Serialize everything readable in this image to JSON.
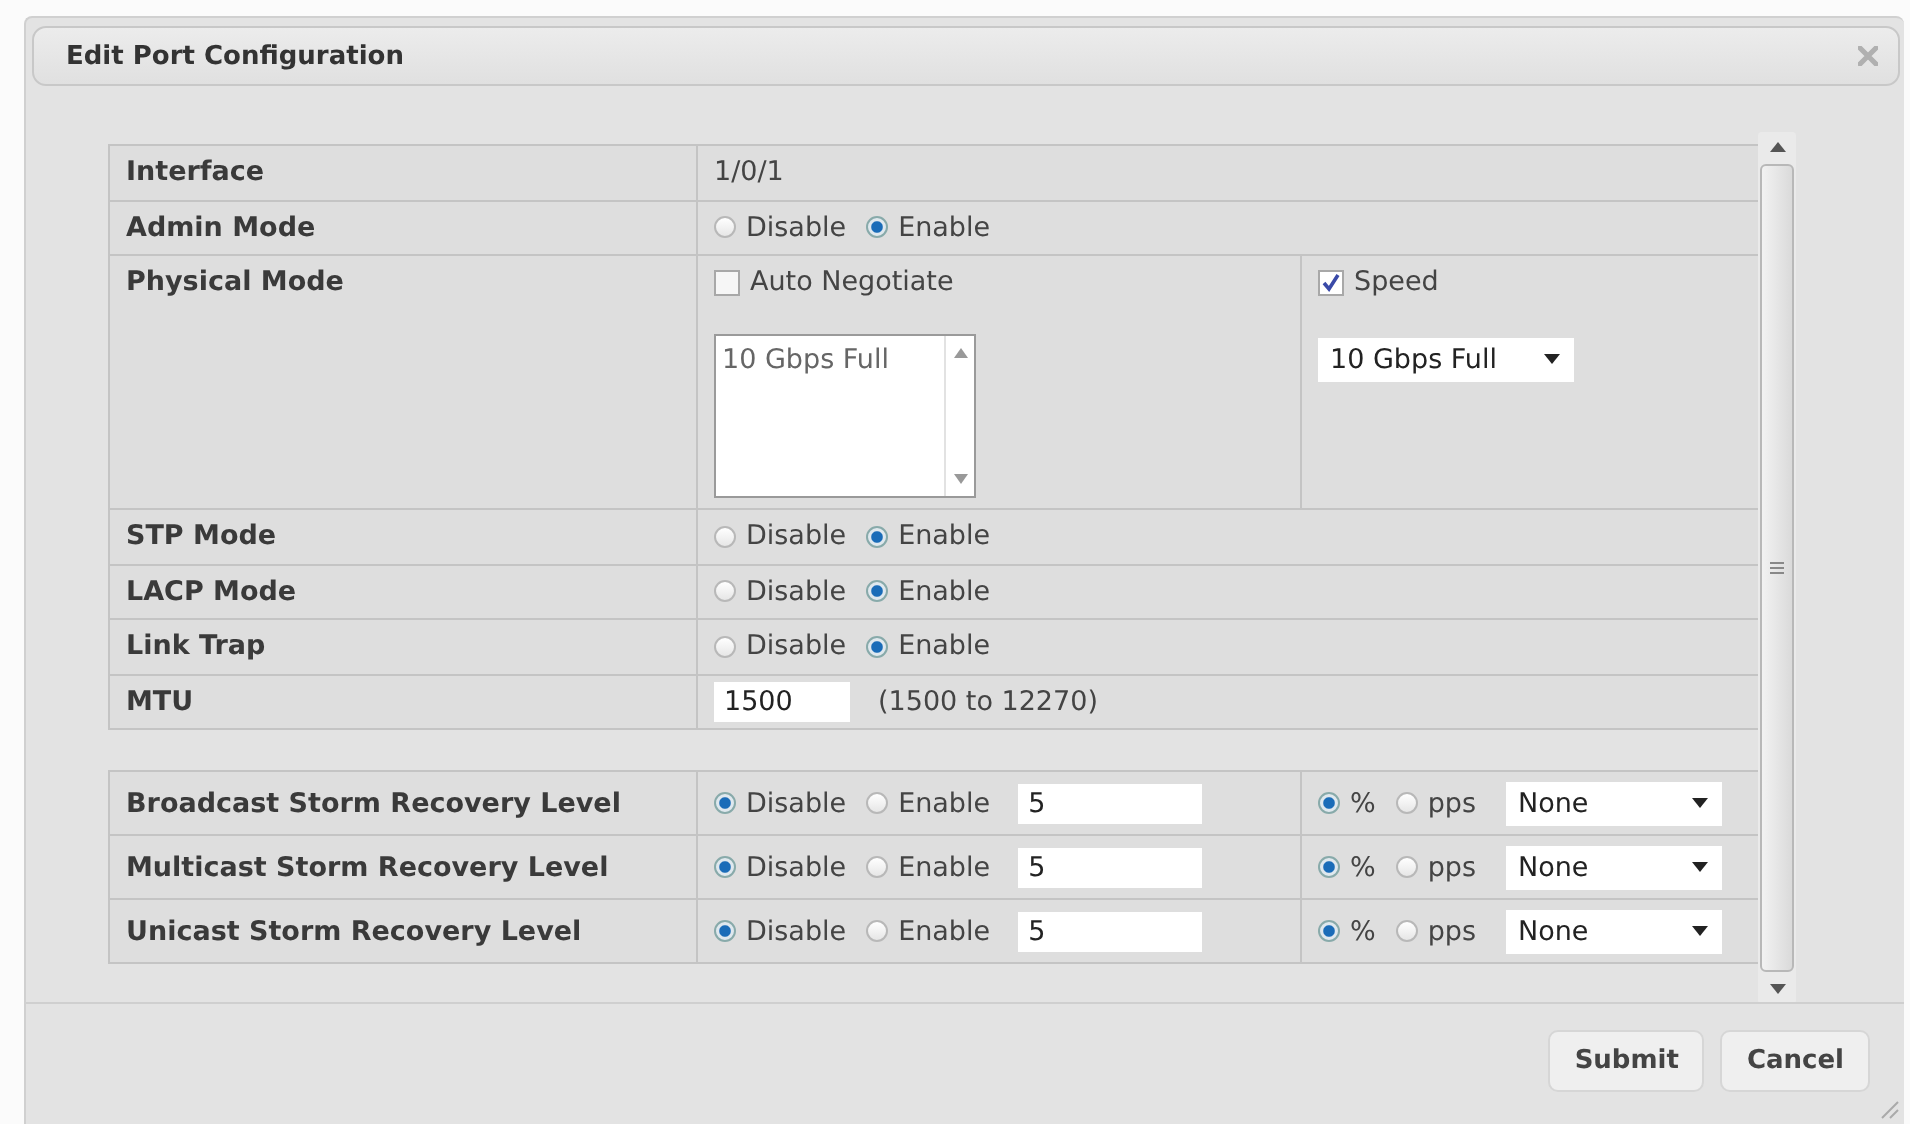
{
  "dialog": {
    "title": "Edit Port Configuration"
  },
  "rows": [
    {
      "kind": "text",
      "label": "Interface",
      "value": "1/0/1"
    },
    {
      "kind": "radio",
      "label": "Admin Mode",
      "options": [
        {
          "label": "Disable",
          "selected": false
        },
        {
          "label": "Enable",
          "selected": true
        }
      ]
    },
    {
      "kind": "physical",
      "label": "Physical Mode",
      "auto_negotiate": {
        "label": "Auto Negotiate",
        "checked": false
      },
      "list_items": [
        "10 Gbps Full"
      ],
      "speed": {
        "label": "Speed",
        "checked": true
      },
      "speed_select": "10 Gbps Full"
    },
    {
      "kind": "radio",
      "label": "STP Mode",
      "options": [
        {
          "label": "Disable",
          "selected": false
        },
        {
          "label": "Enable",
          "selected": true
        }
      ]
    },
    {
      "kind": "radio",
      "label": "LACP Mode",
      "options": [
        {
          "label": "Disable",
          "selected": false
        },
        {
          "label": "Enable",
          "selected": true
        }
      ]
    },
    {
      "kind": "radio",
      "label": "Link Trap",
      "options": [
        {
          "label": "Disable",
          "selected": false
        },
        {
          "label": "Enable",
          "selected": true
        }
      ]
    },
    {
      "kind": "number",
      "label": "MTU",
      "value": "1500",
      "hint": "(1500 to 12270)"
    }
  ],
  "storm_rows": [
    {
      "label": "Broadcast Storm Recovery Level",
      "mode_options": [
        {
          "label": "Disable",
          "selected": true
        },
        {
          "label": "Enable",
          "selected": false
        }
      ],
      "value": "5",
      "unit_options": [
        {
          "label": "%",
          "selected": true
        },
        {
          "label": "pps",
          "selected": false
        }
      ],
      "action": "None"
    },
    {
      "label": "Multicast Storm Recovery Level",
      "mode_options": [
        {
          "label": "Disable",
          "selected": true
        },
        {
          "label": "Enable",
          "selected": false
        }
      ],
      "value": "5",
      "unit_options": [
        {
          "label": "%",
          "selected": true
        },
        {
          "label": "pps",
          "selected": false
        }
      ],
      "action": "None"
    },
    {
      "label": "Unicast Storm Recovery Level",
      "mode_options": [
        {
          "label": "Disable",
          "selected": true
        },
        {
          "label": "Enable",
          "selected": false
        }
      ],
      "value": "5",
      "unit_options": [
        {
          "label": "%",
          "selected": true
        },
        {
          "label": "pps",
          "selected": false
        }
      ],
      "action": "None"
    }
  ],
  "buttons": [
    "Submit",
    "Cancel"
  ]
}
